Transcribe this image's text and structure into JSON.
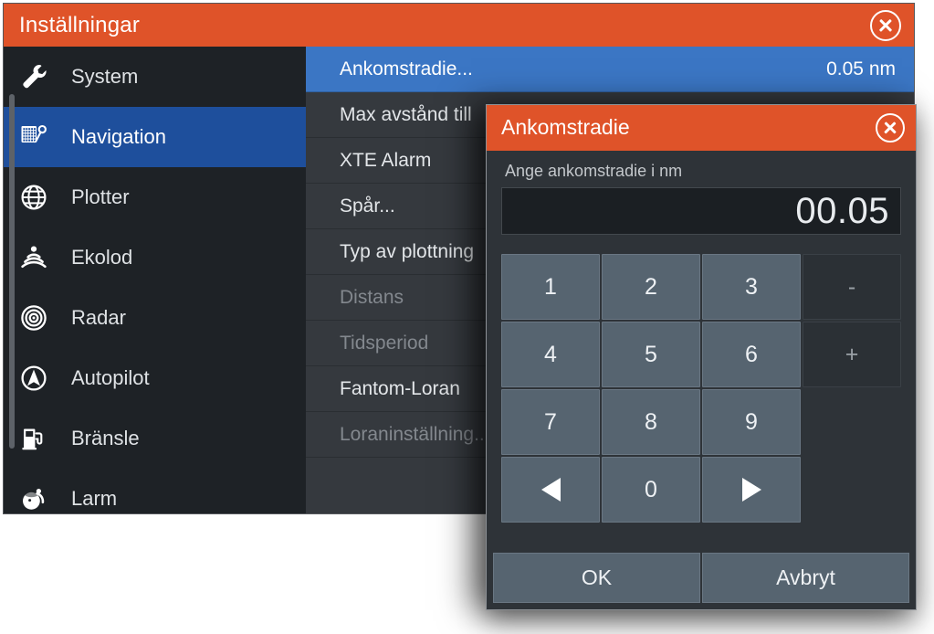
{
  "window": {
    "title": "Inställningar",
    "close_icon": "close-circle-icon"
  },
  "sidebar": {
    "items": [
      {
        "label": "System",
        "icon": "wrench-icon",
        "active": false
      },
      {
        "label": "Navigation",
        "icon": "chart-plot-icon",
        "active": true
      },
      {
        "label": "Plotter",
        "icon": "globe-icon",
        "active": false
      },
      {
        "label": "Ekolod",
        "icon": "sonar-icon",
        "active": false
      },
      {
        "label": "Radar",
        "icon": "radar-icon",
        "active": false
      },
      {
        "label": "Autopilot",
        "icon": "autopilot-icon",
        "active": false
      },
      {
        "label": "Bränsle",
        "icon": "fuel-pump-icon",
        "active": false
      },
      {
        "label": "Larm",
        "icon": "alarm-bell-icon",
        "active": false
      }
    ]
  },
  "menu": {
    "items": [
      {
        "label": "Ankomstradie...",
        "value": "0.05 nm",
        "selected": true,
        "disabled": false
      },
      {
        "label": "Max avstånd till",
        "value": "",
        "selected": false,
        "disabled": false
      },
      {
        "label": "XTE Alarm",
        "value": "",
        "selected": false,
        "disabled": false
      },
      {
        "label": "Spår...",
        "value": "",
        "selected": false,
        "disabled": false
      },
      {
        "label": "Typ av plottning",
        "value": "",
        "selected": false,
        "disabled": false
      },
      {
        "label": "Distans",
        "value": "",
        "selected": false,
        "disabled": true
      },
      {
        "label": "Tidsperiod",
        "value": "",
        "selected": false,
        "disabled": true
      },
      {
        "label": "Fantom-Loran",
        "value": "",
        "selected": false,
        "disabled": false
      },
      {
        "label": "Loraninställning...",
        "value": "",
        "selected": false,
        "disabled": true
      }
    ]
  },
  "dialog": {
    "title": "Ankomstradie",
    "close_icon": "close-circle-icon",
    "prompt": "Ange ankomstradie i nm",
    "value": "00.05",
    "keys": [
      {
        "label": "1",
        "icon": "",
        "dim": false
      },
      {
        "label": "2",
        "icon": "",
        "dim": false
      },
      {
        "label": "3",
        "icon": "",
        "dim": false
      },
      {
        "label": "-",
        "icon": "",
        "dim": true
      },
      {
        "label": "4",
        "icon": "",
        "dim": false
      },
      {
        "label": "5",
        "icon": "",
        "dim": false
      },
      {
        "label": "6",
        "icon": "",
        "dim": false
      },
      {
        "label": "+",
        "icon": "",
        "dim": true
      },
      {
        "label": "7",
        "icon": "",
        "dim": false
      },
      {
        "label": "8",
        "icon": "",
        "dim": false
      },
      {
        "label": "9",
        "icon": "",
        "dim": false
      },
      {
        "label": "",
        "icon": "",
        "dim": false,
        "blank": true
      },
      {
        "label": "",
        "icon": "arrow-left-icon",
        "dim": false
      },
      {
        "label": "0",
        "icon": "",
        "dim": false
      },
      {
        "label": "",
        "icon": "arrow-right-icon",
        "dim": false
      },
      {
        "label": "",
        "icon": "",
        "dim": false,
        "blank": true
      }
    ],
    "ok_label": "OK",
    "cancel_label": "Avbryt"
  },
  "colors": {
    "accent_orange": "#df5329",
    "selection_blue": "#3b76c4",
    "sidebar_active_blue": "#1e4f9c",
    "panel_dark": "#35393e",
    "sidebar_dark": "#1e2226",
    "dialog_bg": "#2e3338",
    "key_slate": "#566470"
  }
}
